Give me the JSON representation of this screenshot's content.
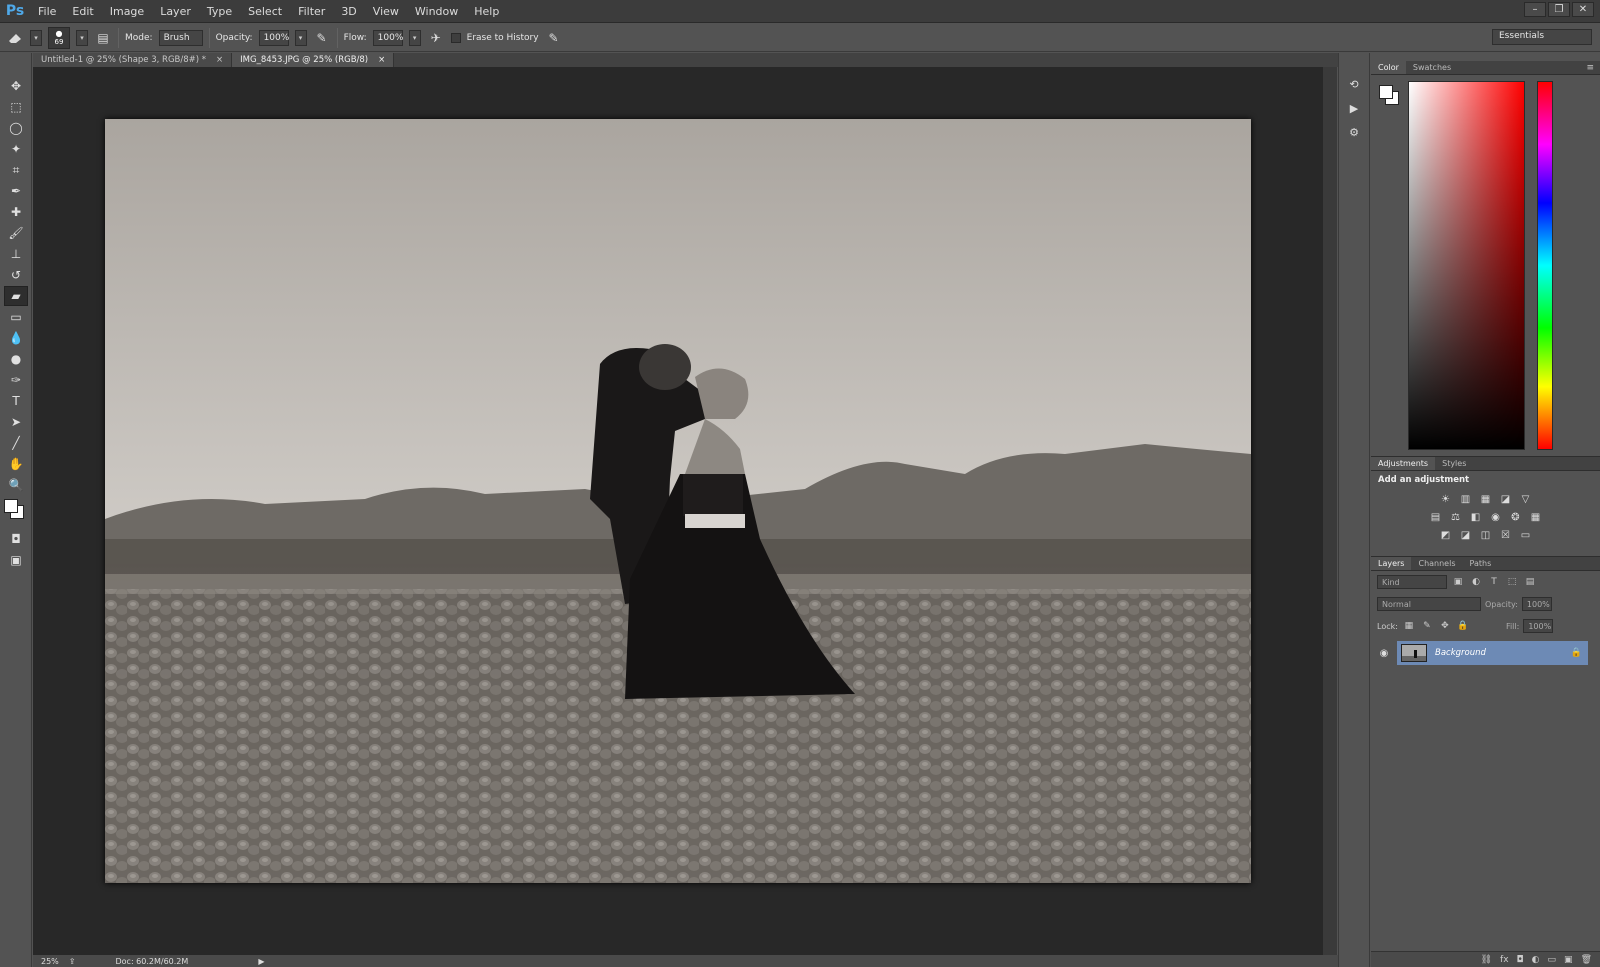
{
  "app": {
    "logo": "Ps"
  },
  "menu": [
    "File",
    "Edit",
    "Image",
    "Layer",
    "Type",
    "Select",
    "Filter",
    "3D",
    "View",
    "Window",
    "Help"
  ],
  "window_controls": {
    "minimize": "–",
    "restore": "❐",
    "close": "✕"
  },
  "options": {
    "brush_size": "69",
    "mode_label": "Mode:",
    "mode_value": "Brush",
    "opacity_label": "Opacity:",
    "opacity_value": "100%",
    "flow_label": "Flow:",
    "flow_value": "100%",
    "erase_history_label": "Erase to History",
    "workspace": "Essentials"
  },
  "tabs": [
    {
      "label": "Untitled-1 @ 25% (Shape 3, RGB/8#) *",
      "close": "×"
    },
    {
      "label": "IMG_8453.JPG @ 25% (RGB/8)",
      "close": "×"
    }
  ],
  "status": {
    "zoom": "25%",
    "doc": "Doc: 60.2M/60.2M",
    "arrow": "▶"
  },
  "panels": {
    "color_tabs": [
      "Color",
      "Swatches"
    ],
    "adjust_tabs": [
      "Adjustments",
      "Styles"
    ],
    "adjust_title": "Add an adjustment",
    "layers_tabs": [
      "Layers",
      "Channels",
      "Paths"
    ],
    "kind_label": "Kind",
    "blend_mode": "Normal",
    "opacity_label": "Opacity:",
    "opacity_value": "100%",
    "lock_label": "Lock:",
    "fill_label": "Fill:",
    "fill_value": "100%",
    "layer_name": "Background"
  },
  "colors": {
    "foreground": "#ffffff",
    "background": "#ffffff",
    "selected_layer": "#6d8ab5"
  }
}
